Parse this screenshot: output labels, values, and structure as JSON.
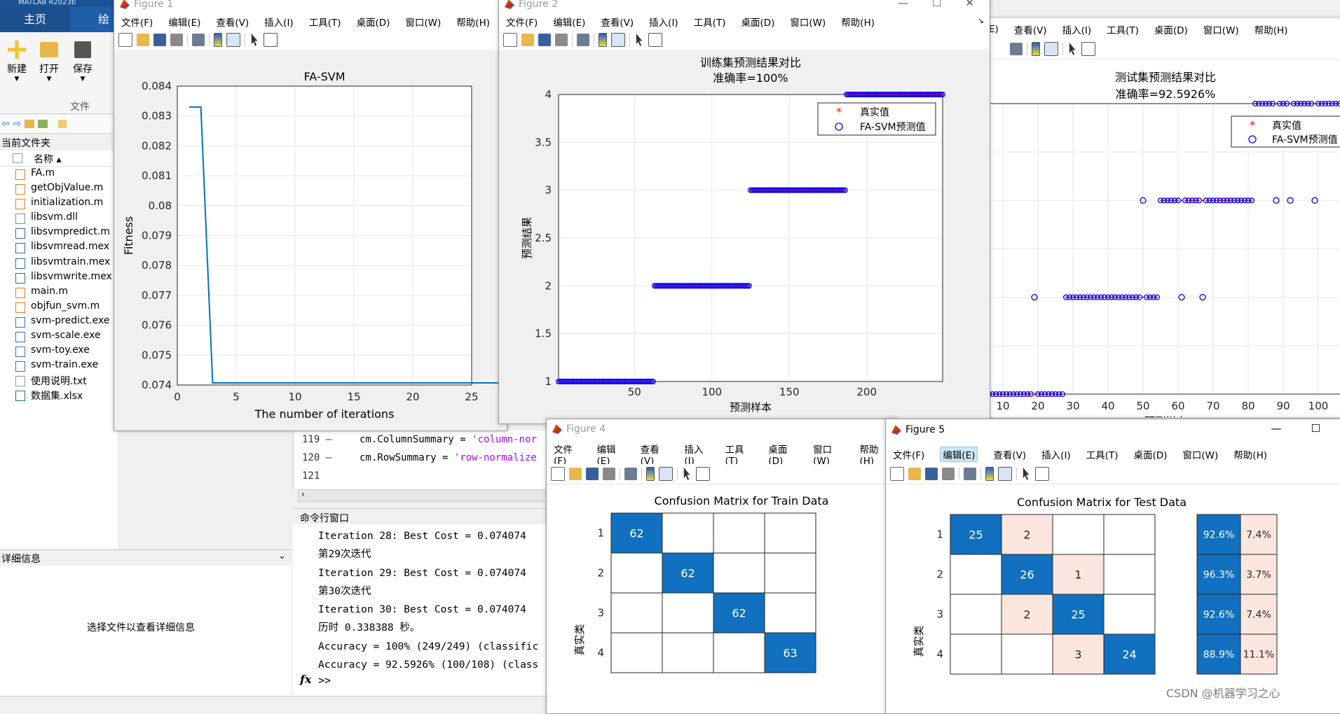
{
  "matlab": {
    "app_title": "MATLAB R2023b",
    "tabs": [
      "主页",
      "绘"
    ],
    "toolstrip": {
      "new": "新建",
      "open": "打开",
      "save": "保存",
      "group": "文件"
    },
    "current_folder_label": "当前文件夹",
    "name_header": "名称 ▴",
    "files": [
      {
        "name": "FA.m",
        "icon": "m-file-icon"
      },
      {
        "name": "getObjValue.m",
        "icon": "m-file-icon"
      },
      {
        "name": "initialization.m",
        "icon": "m-file-icon"
      },
      {
        "name": "libsvm.dll",
        "icon": "file-icon"
      },
      {
        "name": "libsvmpredict.m",
        "icon": "mex-file-icon"
      },
      {
        "name": "libsvmread.mex",
        "icon": "mex-file-icon"
      },
      {
        "name": "libsvmtrain.mex",
        "icon": "mex-file-icon"
      },
      {
        "name": "libsvmwrite.mex",
        "icon": "mex-file-icon"
      },
      {
        "name": "main.m",
        "icon": "m-file-icon"
      },
      {
        "name": "objfun_svm.m",
        "icon": "m-file-icon"
      },
      {
        "name": "svm-predict.exe",
        "icon": "exe-icon"
      },
      {
        "name": "svm-scale.exe",
        "icon": "exe-icon"
      },
      {
        "name": "svm-toy.exe",
        "icon": "exe-icon"
      },
      {
        "name": "svm-train.exe",
        "icon": "exe-icon"
      },
      {
        "name": "使用说明.txt",
        "icon": "txt-icon"
      },
      {
        "name": "数据集.xlsx",
        "icon": "xlsx-icon"
      }
    ],
    "details_label": "详细信息",
    "details_hint": "选择文件以查看详细信息",
    "editor_lines": [
      {
        "num": "119 —",
        "code": "cm.ColumnSummary = ",
        "str": "'column-nor"
      },
      {
        "num": "120 —",
        "code": "cm.RowSummary = ",
        "str": "'row-normalize"
      },
      {
        "num": "121",
        "code": "",
        "str": ""
      }
    ],
    "command_window_label": "命令行窗口",
    "command_lines": [
      "Iteration 28: Best Cost = 0.074074",
      "第29次迭代",
      "Iteration 29: Best Cost = 0.074074",
      "第30次迭代",
      "Iteration 30: Best Cost = 0.074074",
      "历时 0.338388 秒。",
      "Accuracy = 100% (249/249) (classific",
      "Accuracy = 92.5926% (100/108) (class"
    ],
    "prompt": ">>",
    "fx": "fx"
  },
  "menus_full": [
    "文件(F)",
    "编辑(E)",
    "查看(V)",
    "插入(I)",
    "工具(T)",
    "桌面(D)",
    "窗口(W)",
    "帮助(H)"
  ],
  "menus_partial": [
    "E)",
    "查看(V)",
    "插入(I)",
    "工具(T)",
    "桌面(D)",
    "窗口(W)",
    "帮助(H)"
  ],
  "fig1": {
    "title": "Figure 1",
    "chart_data": {
      "type": "line",
      "title": "FA-SVM",
      "xlabel": "The number of iterations",
      "ylabel": "Fitness",
      "xlim": [
        0,
        25
      ],
      "ylim": [
        0.074,
        0.084
      ],
      "xticks": [
        "0",
        "5",
        "10",
        "15",
        "20",
        "25"
      ],
      "yticks": [
        "0.074",
        "0.075",
        "0.076",
        "0.077",
        "0.078",
        "0.079",
        "0.08",
        "0.081",
        "0.082",
        "0.083",
        "0.084"
      ],
      "x": [
        1,
        2,
        3,
        30
      ],
      "y": [
        0.0833,
        0.0833,
        0.07407,
        0.07407
      ],
      "color": "#0072BD"
    }
  },
  "fig2": {
    "title": "Figure 2",
    "chart_data": {
      "type": "scatter",
      "title": "训练集预测结果对比",
      "subtitle": "准确率=100%",
      "xlabel": "预测样本",
      "ylabel": "预测结果",
      "xlim": [
        1,
        249
      ],
      "ylim": [
        1,
        4
      ],
      "xticks": [
        "50",
        "100",
        "150",
        "200"
      ],
      "yticks": [
        "1",
        "1.5",
        "2",
        "2.5",
        "3",
        "3.5",
        "4"
      ],
      "legend": [
        "真实值",
        "FA-SVM预测值"
      ],
      "segments": [
        {
          "from": 1,
          "to": 62,
          "value": 1
        },
        {
          "from": 63,
          "to": 124,
          "value": 2
        },
        {
          "from": 125,
          "to": 186,
          "value": 3
        },
        {
          "from": 187,
          "to": 249,
          "value": 4
        }
      ]
    }
  },
  "fig3": {
    "chart_data": {
      "type": "scatter",
      "title": "测试集预测结果对比",
      "subtitle": "准确率=92.5926%",
      "xlabel": "预测样本",
      "xticks": [
        "10",
        "20",
        "30",
        "40",
        "50",
        "60",
        "70",
        "80",
        "90",
        "100"
      ],
      "legend": [
        "真实值",
        "FA-SVM预测值"
      ],
      "segments": [
        {
          "from": 1,
          "to": 27,
          "value": 1
        },
        {
          "from": 28,
          "to": 54,
          "value": 2
        },
        {
          "from": 55,
          "to": 81,
          "value": 3
        },
        {
          "from": 82,
          "to": 108,
          "value": 4
        }
      ],
      "outliers": [
        {
          "x": 19,
          "value": 2
        },
        {
          "x": 50,
          "value": 3
        },
        {
          "x": 61,
          "value": 2
        },
        {
          "x": 67,
          "value": 2
        },
        {
          "x": 88,
          "value": 3
        },
        {
          "x": 92,
          "value": 3
        },
        {
          "x": 99,
          "value": 3
        }
      ]
    }
  },
  "fig4": {
    "title": "Figure 4",
    "chart_data": {
      "type": "heatmap",
      "title": "Confusion Matrix for Train Data",
      "ylabel": "真实类",
      "row_labels": [
        "1",
        "2",
        "3",
        "4"
      ],
      "matrix": [
        [
          62,
          0,
          0,
          0
        ],
        [
          0,
          62,
          0,
          0
        ],
        [
          0,
          0,
          62,
          0
        ],
        [
          0,
          0,
          0,
          63
        ]
      ]
    }
  },
  "fig5": {
    "title": "Figure 5",
    "chart_data": {
      "type": "heatmap",
      "title": "Confusion Matrix for Test Data",
      "ylabel": "真实类",
      "row_labels": [
        "1",
        "2",
        "3",
        "4"
      ],
      "matrix": [
        [
          25,
          2,
          0,
          0
        ],
        [
          0,
          26,
          1,
          0
        ],
        [
          0,
          2,
          25,
          0
        ],
        [
          0,
          0,
          3,
          24
        ]
      ],
      "row_summary": [
        [
          "92.6%",
          "7.4%"
        ],
        [
          "96.3%",
          "3.7%"
        ],
        [
          "92.6%",
          "7.4%"
        ],
        [
          "88.9%",
          "11.1%"
        ]
      ]
    }
  },
  "watermark": "CSDN @机器学习之心",
  "colors": {
    "blue": "#0072BD",
    "matrix_blue": "#1170C0",
    "matrix_pink": "#FAE6DE",
    "point": "#0000FF",
    "marker_red": "#FF0000"
  }
}
